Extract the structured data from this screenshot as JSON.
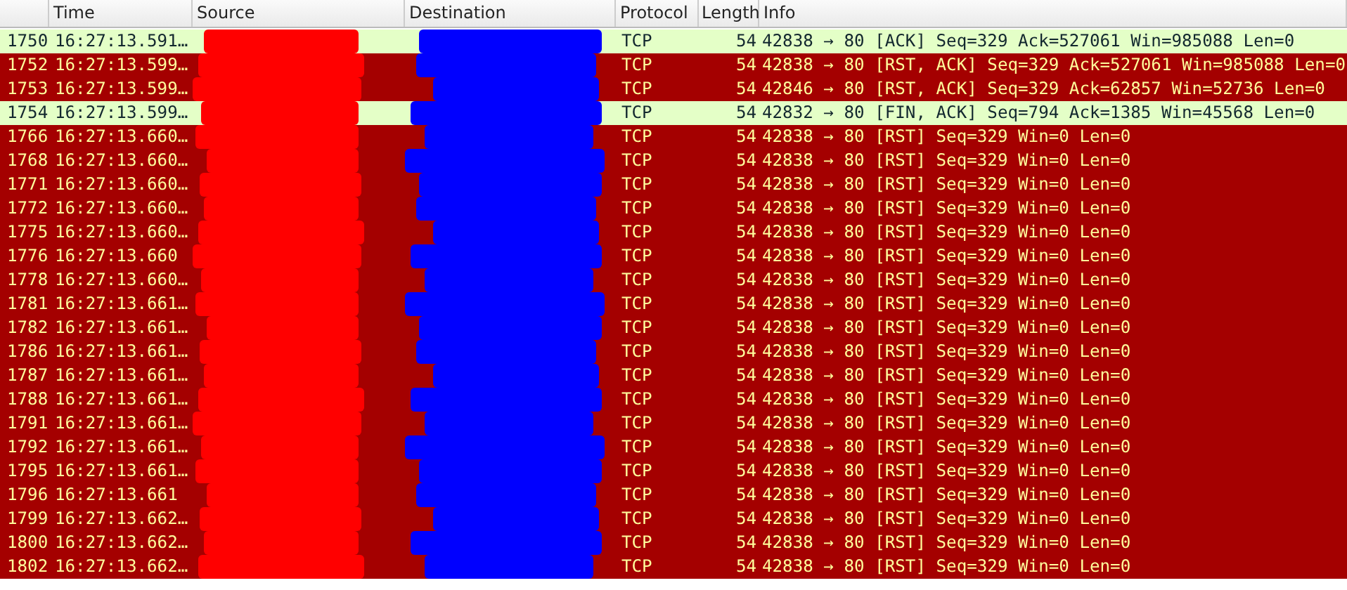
{
  "table": {
    "columns": [
      {},
      {
        "label": "Time"
      },
      {
        "label": "Source"
      },
      {
        "label": "Destination"
      },
      {
        "label": "Protocol"
      },
      {
        "label": "Length"
      },
      {
        "label": "Info"
      }
    ],
    "rows": [
      {
        "kind": "normal",
        "no": "1750",
        "time": "16:27:13.591…",
        "protocol": "TCP",
        "length": "54",
        "info": "42838 → 80 [ACK] Seq=329 Ack=527061 Win=985088 Len=0"
      },
      {
        "kind": "error",
        "no": "1752",
        "time": "16:27:13.599…",
        "protocol": "TCP",
        "length": "54",
        "info": "42838 → 80 [RST, ACK] Seq=329 Ack=527061 Win=985088 Len=0"
      },
      {
        "kind": "error",
        "no": "1753",
        "time": "16:27:13.599…",
        "protocol": "TCP",
        "length": "54",
        "info": "42846 → 80 [RST, ACK] Seq=329 Ack=62857 Win=52736 Len=0"
      },
      {
        "kind": "normal",
        "no": "1754",
        "time": "16:27:13.599…",
        "protocol": "TCP",
        "length": "54",
        "info": "42832 → 80 [FIN, ACK] Seq=794 Ack=1385 Win=45568 Len=0"
      },
      {
        "kind": "error",
        "no": "1766",
        "time": "16:27:13.660…",
        "protocol": "TCP",
        "length": "54",
        "info": "42838 → 80 [RST] Seq=329 Win=0 Len=0"
      },
      {
        "kind": "error",
        "no": "1768",
        "time": "16:27:13.660…",
        "protocol": "TCP",
        "length": "54",
        "info": "42838 → 80 [RST] Seq=329 Win=0 Len=0"
      },
      {
        "kind": "error",
        "no": "1771",
        "time": "16:27:13.660…",
        "protocol": "TCP",
        "length": "54",
        "info": "42838 → 80 [RST] Seq=329 Win=0 Len=0"
      },
      {
        "kind": "error",
        "no": "1772",
        "time": "16:27:13.660…",
        "protocol": "TCP",
        "length": "54",
        "info": "42838 → 80 [RST] Seq=329 Win=0 Len=0"
      },
      {
        "kind": "error",
        "no": "1775",
        "time": "16:27:13.660…",
        "protocol": "TCP",
        "length": "54",
        "info": "42838 → 80 [RST] Seq=329 Win=0 Len=0"
      },
      {
        "kind": "error",
        "no": "1776",
        "time": "16:27:13.660",
        "protocol": "TCP",
        "length": "54",
        "info": "42838 → 80 [RST] Seq=329 Win=0 Len=0"
      },
      {
        "kind": "error",
        "no": "1778",
        "time": "16:27:13.660…",
        "protocol": "TCP",
        "length": "54",
        "info": "42838 → 80 [RST] Seq=329 Win=0 Len=0"
      },
      {
        "kind": "error",
        "no": "1781",
        "time": "16:27:13.661…",
        "protocol": "TCP",
        "length": "54",
        "info": "42838 → 80 [RST] Seq=329 Win=0 Len=0"
      },
      {
        "kind": "error",
        "no": "1782",
        "time": "16:27:13.661…",
        "protocol": "TCP",
        "length": "54",
        "info": "42838 → 80 [RST] Seq=329 Win=0 Len=0"
      },
      {
        "kind": "error",
        "no": "1786",
        "time": "16:27:13.661…",
        "protocol": "TCP",
        "length": "54",
        "info": "42838 → 80 [RST] Seq=329 Win=0 Len=0"
      },
      {
        "kind": "error",
        "no": "1787",
        "time": "16:27:13.661…",
        "protocol": "TCP",
        "length": "54",
        "info": "42838 → 80 [RST] Seq=329 Win=0 Len=0"
      },
      {
        "kind": "error",
        "no": "1788",
        "time": "16:27:13.661…",
        "protocol": "TCP",
        "length": "54",
        "info": "42838 → 80 [RST] Seq=329 Win=0 Len=0"
      },
      {
        "kind": "error",
        "no": "1791",
        "time": "16:27:13.661…",
        "protocol": "TCP",
        "length": "54",
        "info": "42838 → 80 [RST] Seq=329 Win=0 Len=0"
      },
      {
        "kind": "error",
        "no": "1792",
        "time": "16:27:13.661…",
        "protocol": "TCP",
        "length": "54",
        "info": "42838 → 80 [RST] Seq=329 Win=0 Len=0"
      },
      {
        "kind": "error",
        "no": "1795",
        "time": "16:27:13.661…",
        "protocol": "TCP",
        "length": "54",
        "info": "42838 → 80 [RST] Seq=329 Win=0 Len=0"
      },
      {
        "kind": "error",
        "no": "1796",
        "time": "16:27:13.661",
        "protocol": "TCP",
        "length": "54",
        "info": "42838 → 80 [RST] Seq=329 Win=0 Len=0"
      },
      {
        "kind": "error",
        "no": "1799",
        "time": "16:27:13.662…",
        "protocol": "TCP",
        "length": "54",
        "info": "42838 → 80 [RST] Seq=329 Win=0 Len=0"
      },
      {
        "kind": "error",
        "no": "1800",
        "time": "16:27:13.662…",
        "protocol": "TCP",
        "length": "54",
        "info": "42838 → 80 [RST] Seq=329 Win=0 Len=0"
      },
      {
        "kind": "error",
        "no": "1802",
        "time": "16:27:13.662…",
        "protocol": "TCP",
        "length": "54",
        "info": "42838 → 80 [RST] Seq=329 Win=0 Len=0"
      }
    ]
  }
}
